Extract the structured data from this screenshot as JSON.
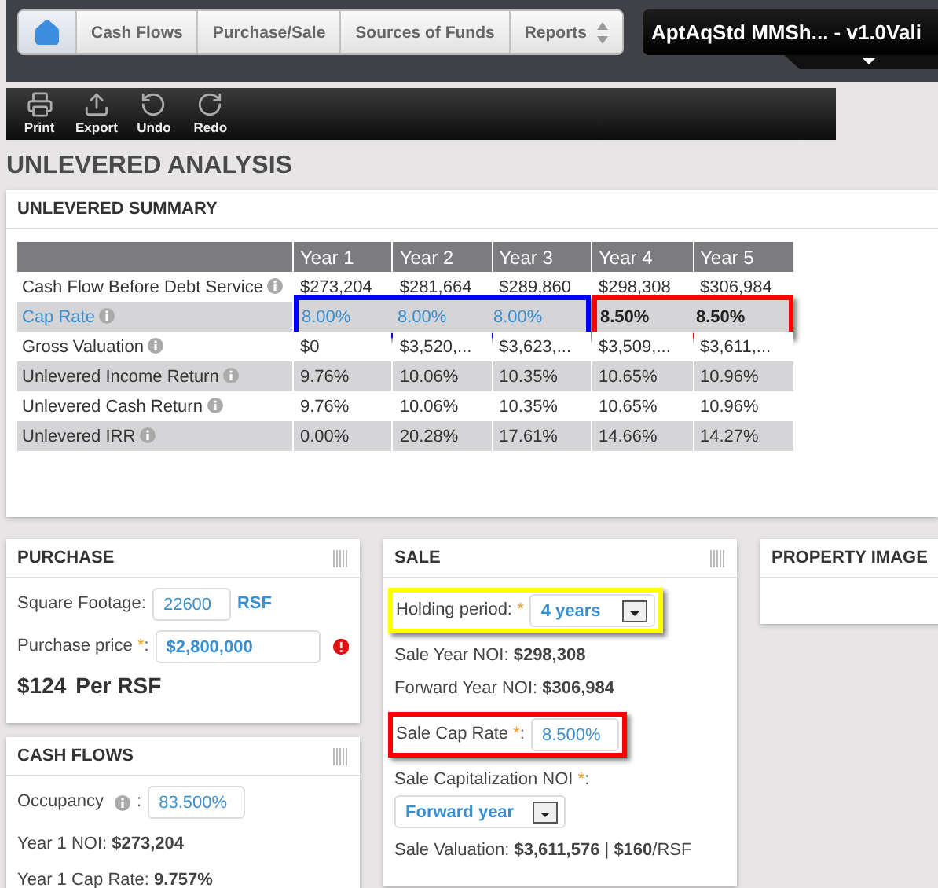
{
  "nav": {
    "tabs": [
      {
        "kind": "home",
        "selected": true
      },
      {
        "kind": "text",
        "label": "Cash Flows",
        "selected": false
      },
      {
        "kind": "text",
        "label": "Purchase/Sale",
        "selected": false
      },
      {
        "kind": "text",
        "label": "Sources of Funds",
        "selected": false
      },
      {
        "kind": "sort",
        "label": "Reports",
        "selected": false
      }
    ],
    "file_title": "AptAqStd MMSh... - v1.0Vali"
  },
  "toolbar": [
    {
      "kind": "print",
      "label": "Print"
    },
    {
      "kind": "export",
      "label": "Export"
    },
    {
      "kind": "undo",
      "label": "Undo"
    },
    {
      "kind": "redo",
      "label": "Redo"
    }
  ],
  "page_title": "UNLEVERED ANALYSIS",
  "summary": {
    "title": "UNLEVERED SUMMARY",
    "columns": [
      "Year 1",
      "Year 2",
      "Year 3",
      "Year 4",
      "Year 5"
    ],
    "rows": [
      {
        "label": "Cash Flow Before Debt Service",
        "kind": "plain",
        "values": [
          "$273,204",
          "$281,664",
          "$289,860",
          "$298,308",
          "$306,984"
        ]
      },
      {
        "label": "Cap Rate",
        "kind": "groups",
        "groups": [
          {
            "kind": "input",
            "color": "#0000ff",
            "values": [
              "8.00%",
              "8.00%",
              "8.00%"
            ]
          },
          {
            "kind": "computed",
            "color": "#ff0000",
            "values": [
              "8.50%",
              "8.50%"
            ]
          }
        ]
      },
      {
        "label": "Gross Valuation",
        "kind": "plain",
        "values": [
          "$0",
          "$3,520,...",
          "$3,623,...",
          "$3,509,...",
          "$3,611,..."
        ]
      },
      {
        "label": "Unlevered Income Return",
        "kind": "plain",
        "values": [
          "9.76%",
          "10.06%",
          "10.35%",
          "10.65%",
          "10.96%"
        ]
      },
      {
        "label": "Unlevered Cash Return",
        "kind": "plain",
        "values": [
          "9.76%",
          "10.06%",
          "10.35%",
          "10.65%",
          "10.96%"
        ]
      },
      {
        "label": "Unlevered IRR",
        "kind": "plain",
        "values": [
          "0.00%",
          "20.28%",
          "17.61%",
          "14.66%",
          "14.27%"
        ]
      }
    ]
  },
  "purchase": {
    "title": "PURCHASE",
    "square_footage": {
      "label": "Square Footage:",
      "value": "22600",
      "unit": "RSF"
    },
    "purchase_price": {
      "label": "Purchase price ",
      "required": "*",
      "after": ":",
      "value": "$2,800,000",
      "error": true
    },
    "per_rsf": {
      "amount": "$124",
      "unit": "Per RSF"
    }
  },
  "cash_flows": {
    "title": "CASH FLOWS",
    "occupancy": {
      "label": "Occupancy",
      "after": " :",
      "value": "83.500%"
    },
    "lines": [
      "Year 1 NOI: **$273,204**",
      "Year 1 Cap Rate: **9.757%**"
    ]
  },
  "sale": {
    "title": "SALE",
    "holding_period": {
      "label": "Holding period: ",
      "required": "*",
      "value": "4 years",
      "color": "#ffff00"
    },
    "lines": [
      "Sale Year NOI: **$298,308**",
      "Forward Year NOI: **$306,984**"
    ],
    "sale_cap_rate": {
      "label": "Sale Cap Rate ",
      "required": "*",
      "after": ":",
      "value": "8.500%",
      "color": "#ff0000"
    },
    "cap_noi": {
      "label": "Sale Capitalization NOI ",
      "required": "*",
      "after": ":",
      "value": "Forward year"
    },
    "valuation": "Sale Valuation: **$3,611,576** |  **$160**/RSF"
  },
  "property_image": {
    "title": "PROPERTY IMAGE"
  }
}
